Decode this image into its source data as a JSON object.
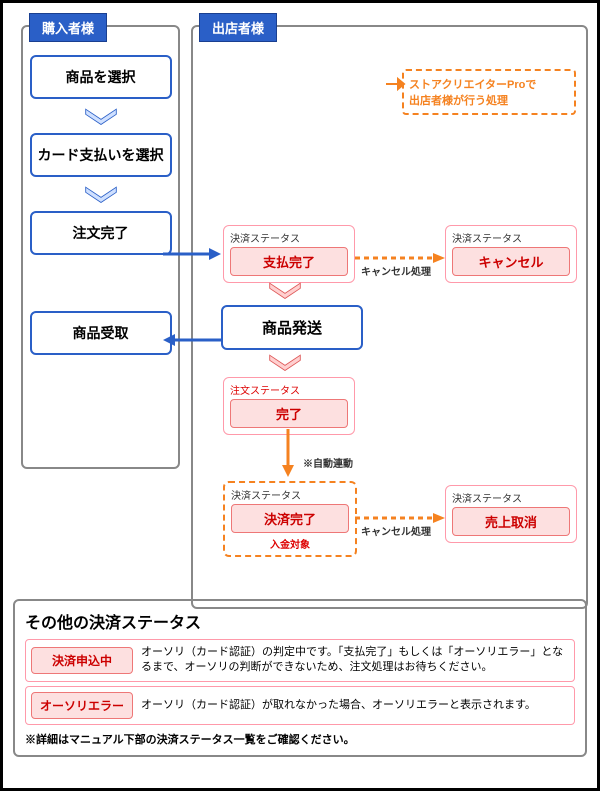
{
  "buyer": {
    "header": "購入者様",
    "steps": [
      "商品を選択",
      "カード支払いを選択",
      "注文完了",
      "商品受取"
    ]
  },
  "seller": {
    "header": "出店者様",
    "legend": "ストアクリエイターProで\n出店者様が行う処理",
    "payment_done": {
      "title": "決済ステータス",
      "label": "支払完了"
    },
    "cancel": {
      "title": "決済ステータス",
      "label": "キャンセル"
    },
    "cancel_label": "キャンセル処理",
    "ship": "商品発送",
    "order_done": {
      "title": "注文ステータス",
      "label": "完了"
    },
    "auto_link": "※自動連動",
    "settle_done": {
      "title": "決済ステータス",
      "label": "決済完了",
      "note": "入金対象"
    },
    "sale_cancel": {
      "title": "決済ステータス",
      "label": "売上取消"
    },
    "cancel_label2": "キャンセル処理"
  },
  "footer": {
    "title": "その他の決済ステータス",
    "rows": [
      {
        "tag": "決済申込中",
        "desc": "オーソリ（カード認証）の判定中です。「支払完了」もしくは「オーソリエラー」となるまで、オーソリの判断ができないため、注文処理はお待ちください。"
      },
      {
        "tag": "オーソリエラー",
        "desc": "オーソリ（カード認証）が取れなかった場合、オーソリエラーと表示されます。"
      }
    ],
    "note": "※詳細はマニュアル下部の決済ステータス一覧をご確認ください。"
  }
}
